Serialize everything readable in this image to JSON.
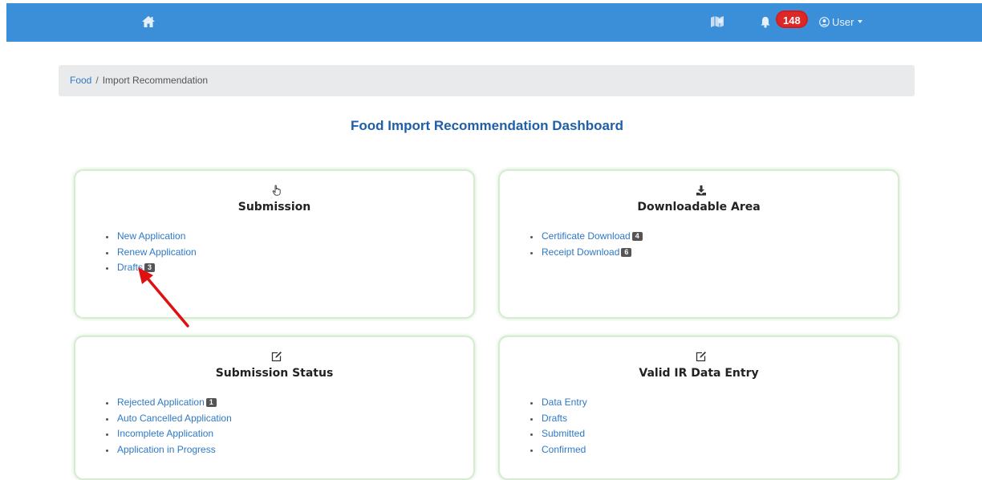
{
  "navbar": {
    "notification_count": "148",
    "user_label": "User",
    "bar_color": "#3a8fd8",
    "icons": [
      "home-icon",
      "map-icon",
      "bell-icon",
      "user-circle-icon",
      "caret-down-icon"
    ]
  },
  "breadcrumb": {
    "items": [
      "Food",
      "Import Recommendation"
    ],
    "separator": "/"
  },
  "page": {
    "title": "Food Import Recommendation Dashboard"
  },
  "cards": [
    {
      "icon": "pointer-hand-icon",
      "title": "Submission",
      "links": [
        {
          "label": "New Application",
          "count": null
        },
        {
          "label": "Renew Application",
          "count": null
        },
        {
          "label": "Drafts",
          "count": "3"
        }
      ]
    },
    {
      "icon": "download-icon",
      "title": "Downloadable Area",
      "links": [
        {
          "label": "Certificate Download",
          "count": "4"
        },
        {
          "label": "Receipt Download",
          "count": "6"
        }
      ]
    },
    {
      "icon": "edit-icon",
      "title": "Submission Status",
      "links": [
        {
          "label": "Rejected Application",
          "count": "1"
        },
        {
          "label": "Auto Cancelled Application",
          "count": null
        },
        {
          "label": "Incomplete Application",
          "count": null
        },
        {
          "label": "Application in Progress",
          "count": null
        }
      ]
    },
    {
      "icon": "edit-icon",
      "title": "Valid IR Data Entry",
      "links": [
        {
          "label": "Data Entry",
          "count": null
        },
        {
          "label": "Drafts",
          "count": null
        },
        {
          "label": "Submitted",
          "count": null
        },
        {
          "label": "Confirmed",
          "count": null
        }
      ]
    }
  ],
  "annotation": {
    "icon": "red-arrow-icon",
    "color": "#e01010"
  }
}
